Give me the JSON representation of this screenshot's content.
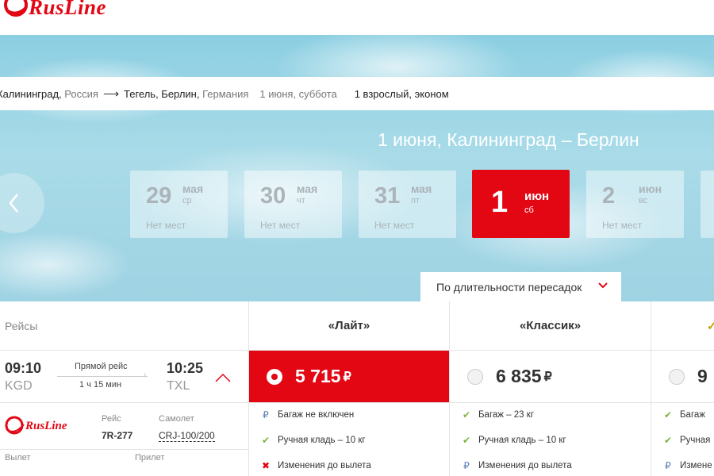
{
  "brand": {
    "name": "RusLine"
  },
  "search": {
    "from_city": "Калининград,",
    "from_country": "Россия",
    "to_city": "Тегель, Берлин,",
    "to_country": "Германия",
    "date": "1 июня, суббота",
    "passengers": "1 взрослый, эконом"
  },
  "route_title": "1 июня, Калининград – Берлин",
  "dates": [
    {
      "day": "29",
      "month": "мая",
      "weekday": "ср",
      "status": "Нет мест"
    },
    {
      "day": "30",
      "month": "мая",
      "weekday": "чт",
      "status": "Нет мест"
    },
    {
      "day": "31",
      "month": "мая",
      "weekday": "пт",
      "status": "Нет мест"
    },
    {
      "day": "1",
      "month": "июн",
      "weekday": "сб",
      "status": ""
    },
    {
      "day": "2",
      "month": "июн",
      "weekday": "вс",
      "status": "Нет мест"
    }
  ],
  "sort": {
    "label": "По длительности пересадок"
  },
  "table": {
    "flights_header": "Рейсы",
    "fares": [
      {
        "name": "«Лайт»",
        "price": "5 715",
        "currency": "₽",
        "selected": true
      },
      {
        "name": "«Классик»",
        "price": "6 835",
        "currency": "₽",
        "selected": false
      },
      {
        "name": "",
        "price": "9",
        "currency": "",
        "selected": false
      }
    ]
  },
  "flight": {
    "dep_time": "09:10",
    "dep_code": "KGD",
    "arr_time": "10:25",
    "arr_code": "TXL",
    "type": "Прямой рейс",
    "duration": "1 ч 15 мин",
    "airline_logo_text": "RusLine",
    "flight_label": "Рейс",
    "flight_no": "7R-277",
    "aircraft_label": "Самолет",
    "aircraft": "CRJ-100/200",
    "departure_label": "Вылет",
    "arrival_label": "Прилет"
  },
  "features": {
    "lite": [
      {
        "icon": "ruble",
        "text": "Багаж не включен"
      },
      {
        "icon": "check",
        "text": "Ручная кладь – 10 кг"
      },
      {
        "icon": "cross",
        "text": "Изменения до вылета"
      }
    ],
    "classic": [
      {
        "icon": "check",
        "text": "Багаж – 23 кг"
      },
      {
        "icon": "check",
        "text": "Ручная кладь – 10 кг"
      },
      {
        "icon": "ruble",
        "text": "Изменения до вылета"
      }
    ],
    "third": [
      {
        "icon": "check",
        "text": "Багаж"
      },
      {
        "icon": "check",
        "text": "Ручная"
      },
      {
        "icon": "ruble",
        "text": "Измене"
      }
    ]
  },
  "colors": {
    "brand_red": "#e30613",
    "check_green": "#7cb342",
    "ruble_blue": "#5b7fb7"
  }
}
